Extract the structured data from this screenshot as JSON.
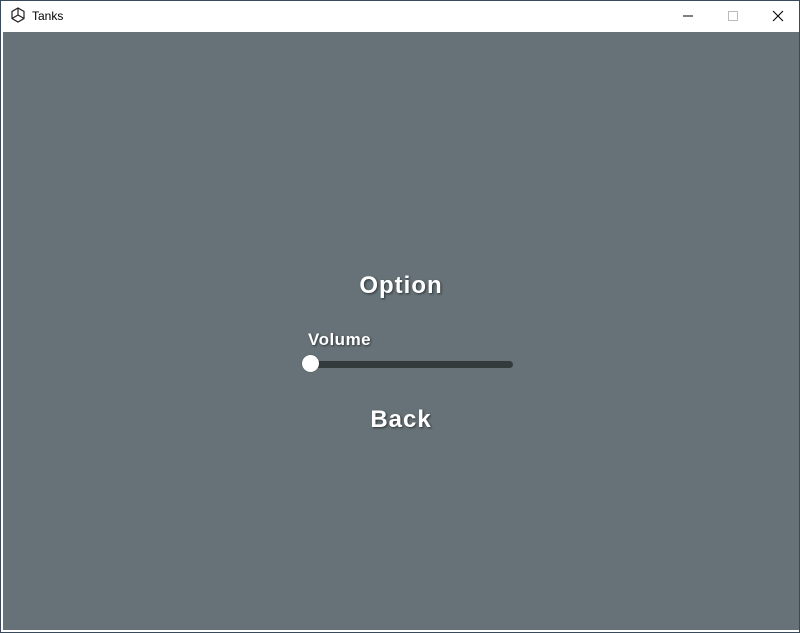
{
  "window": {
    "title": "Tanks",
    "icon": "unity-logo-icon",
    "controls": {
      "minimize_icon": "minimize-icon",
      "maximize_icon": "maximize-icon",
      "close_icon": "close-icon"
    }
  },
  "menu": {
    "heading": "Option",
    "volume_label": "Volume",
    "volume_value": 0.0,
    "back_label": "Back"
  },
  "colors": {
    "background": "#667277",
    "slider_track": "#343b3c",
    "text": "#ffffff",
    "titlebar": "#ffffff"
  }
}
